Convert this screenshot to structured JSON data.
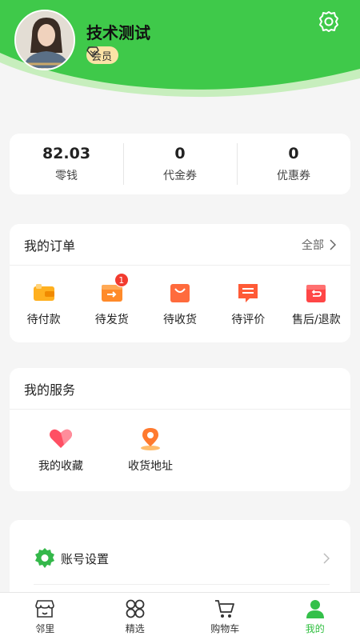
{
  "profile": {
    "username": "技术测试",
    "badge": "会员"
  },
  "wallet": [
    {
      "value": "82.03",
      "label": "零钱"
    },
    {
      "value": "0",
      "label": "代金券"
    },
    {
      "value": "0",
      "label": "优惠券"
    }
  ],
  "orders": {
    "title": "我的订单",
    "all_label": "全部",
    "items": [
      {
        "label": "待付款",
        "icon": "wallet-icon"
      },
      {
        "label": "待发货",
        "icon": "shipping-box-icon",
        "badge": "1"
      },
      {
        "label": "待收货",
        "icon": "shopping-bag-icon"
      },
      {
        "label": "待评价",
        "icon": "comment-icon"
      },
      {
        "label": "售后/退款",
        "icon": "return-icon"
      }
    ]
  },
  "services": {
    "title": "我的服务",
    "items": [
      {
        "label": "我的收藏",
        "icon": "heart-icon"
      },
      {
        "label": "收货地址",
        "icon": "location-pin-icon"
      }
    ]
  },
  "account": {
    "label": "账号设置"
  },
  "tabbar": [
    {
      "label": "邻里",
      "icon": "store-icon"
    },
    {
      "label": "精选",
      "icon": "grid-icon"
    },
    {
      "label": "购物车",
      "icon": "cart-icon"
    },
    {
      "label": "我的",
      "icon": "user-icon",
      "active": true
    }
  ],
  "colors": {
    "brand_green": "#3fc94a",
    "badge_red": "#f23b2f",
    "badge_gold": "#fbe3a6"
  }
}
